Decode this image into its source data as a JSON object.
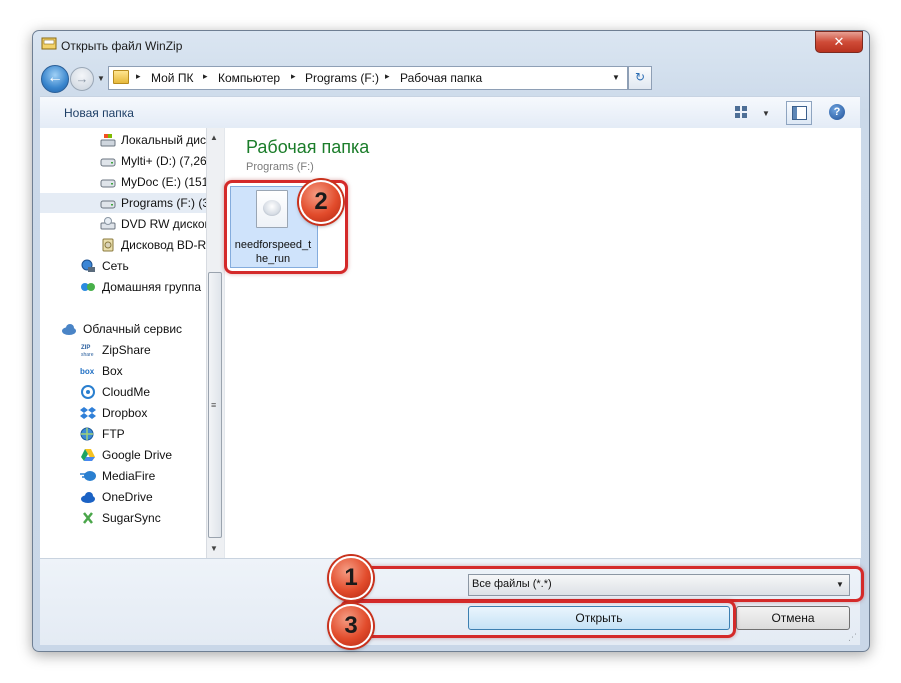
{
  "window": {
    "title": "Открыть файл WinZip",
    "close_label": "✕"
  },
  "nav": {
    "back_glyph": "←",
    "forward_glyph": "→",
    "refresh_glyph": "↻",
    "breadcrumbs": [
      "Мой ПК",
      "Компьютер",
      "Programs (F:)",
      "Рабочая папка"
    ],
    "separator": "▸",
    "dropdown": "▼"
  },
  "toolbar": {
    "new_folder_label": "Новая папка",
    "view_dropdown": "▼",
    "help_glyph": "?"
  },
  "sidebar": {
    "items": [
      {
        "label": "Локальный дис",
        "icon": "local-disk-icon"
      },
      {
        "label": "Mylti+ (D:) (7,26",
        "icon": "drive-icon"
      },
      {
        "label": "MyDoc (E:) (151",
        "icon": "drive-icon"
      },
      {
        "label": "Programs (F:) (3",
        "icon": "drive-icon",
        "selected": true
      },
      {
        "label": "DVD RW дисков",
        "icon": "dvd-icon"
      },
      {
        "label": "Дисковод BD-R",
        "icon": "bd-drive-icon"
      },
      {
        "label": "Сеть",
        "icon": "network-icon"
      },
      {
        "label": "Домашняя группа",
        "icon": "homegroup-icon"
      },
      {
        "label": "Облачный сервис",
        "icon": "cloud-icon"
      },
      {
        "label": "ZipShare",
        "icon": "zipshare-icon"
      },
      {
        "label": "Box",
        "icon": "box-icon"
      },
      {
        "label": "CloudMe",
        "icon": "cloudme-icon"
      },
      {
        "label": "Dropbox",
        "icon": "dropbox-icon"
      },
      {
        "label": "FTP",
        "icon": "ftp-icon"
      },
      {
        "label": "Google Drive",
        "icon": "google-drive-icon"
      },
      {
        "label": "MediaFire",
        "icon": "mediafire-icon"
      },
      {
        "label": "OneDrive",
        "icon": "onedrive-icon"
      },
      {
        "label": "SugarSync",
        "icon": "sugarsync-icon"
      }
    ],
    "scroll_up": "▲",
    "scroll_down": "▼",
    "scroll_grip": "≡"
  },
  "content": {
    "folder_title": "Рабочая папка",
    "folder_subtitle": "Programs (F:)",
    "files": [
      {
        "name_line1": "needforspeed_t",
        "name_line2": "he_run",
        "icon": "java-file-icon"
      }
    ]
  },
  "footer": {
    "filetype_value": "Все файлы (*.*)",
    "filetype_dropdown": "▼",
    "open_label": "Открыть",
    "cancel_label": "Отмена",
    "resize_grip": "⋰"
  },
  "annotations": {
    "badge1": "1",
    "badge2": "2",
    "badge3": "3",
    "highlight_color": "#d42a2a"
  }
}
